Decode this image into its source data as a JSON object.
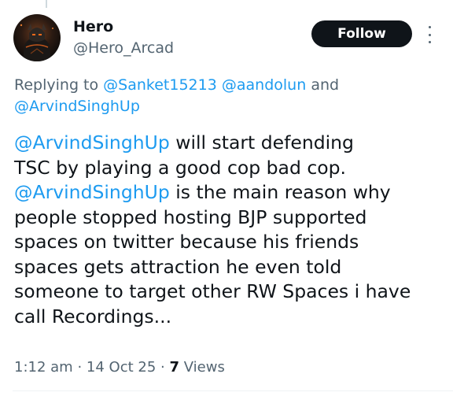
{
  "author": {
    "display_name": "Hero",
    "handle": "@Hero_Arcad"
  },
  "actions": {
    "follow_label": "Follow",
    "more_icon": "more-vertical-icon"
  },
  "replying": {
    "prefix": "Replying to",
    "mentions": [
      "@Sanket15213",
      "@aandolun",
      "@ArvindSinghUp"
    ],
    "joiner": "and"
  },
  "post": {
    "lines": [
      {
        "mention": "@ArvindSinghUp",
        "text": " will start defending"
      },
      {
        "mention": "",
        "text": "TSC by playing a good cop bad cop."
      },
      {
        "mention": "@ArvindSinghUp",
        "text": " is the main reason why"
      },
      {
        "mention": "",
        "text": "people stopped hosting BJP supported"
      },
      {
        "mention": "",
        "text": "spaces on twitter because his friends"
      },
      {
        "mention": "",
        "text": "spaces gets attraction he even told"
      },
      {
        "mention": "",
        "text": "someone to target other RW Spaces i have"
      },
      {
        "mention": "",
        "text": "call Recordings..."
      }
    ]
  },
  "meta": {
    "time": "1:12 am",
    "date": "14 Oct 25",
    "views_count": "7",
    "views_label": "Views",
    "separator": "·"
  },
  "colors": {
    "link": "#1d9bf0",
    "muted": "#536471",
    "text": "#0f1419",
    "button_bg": "#0f1419"
  }
}
